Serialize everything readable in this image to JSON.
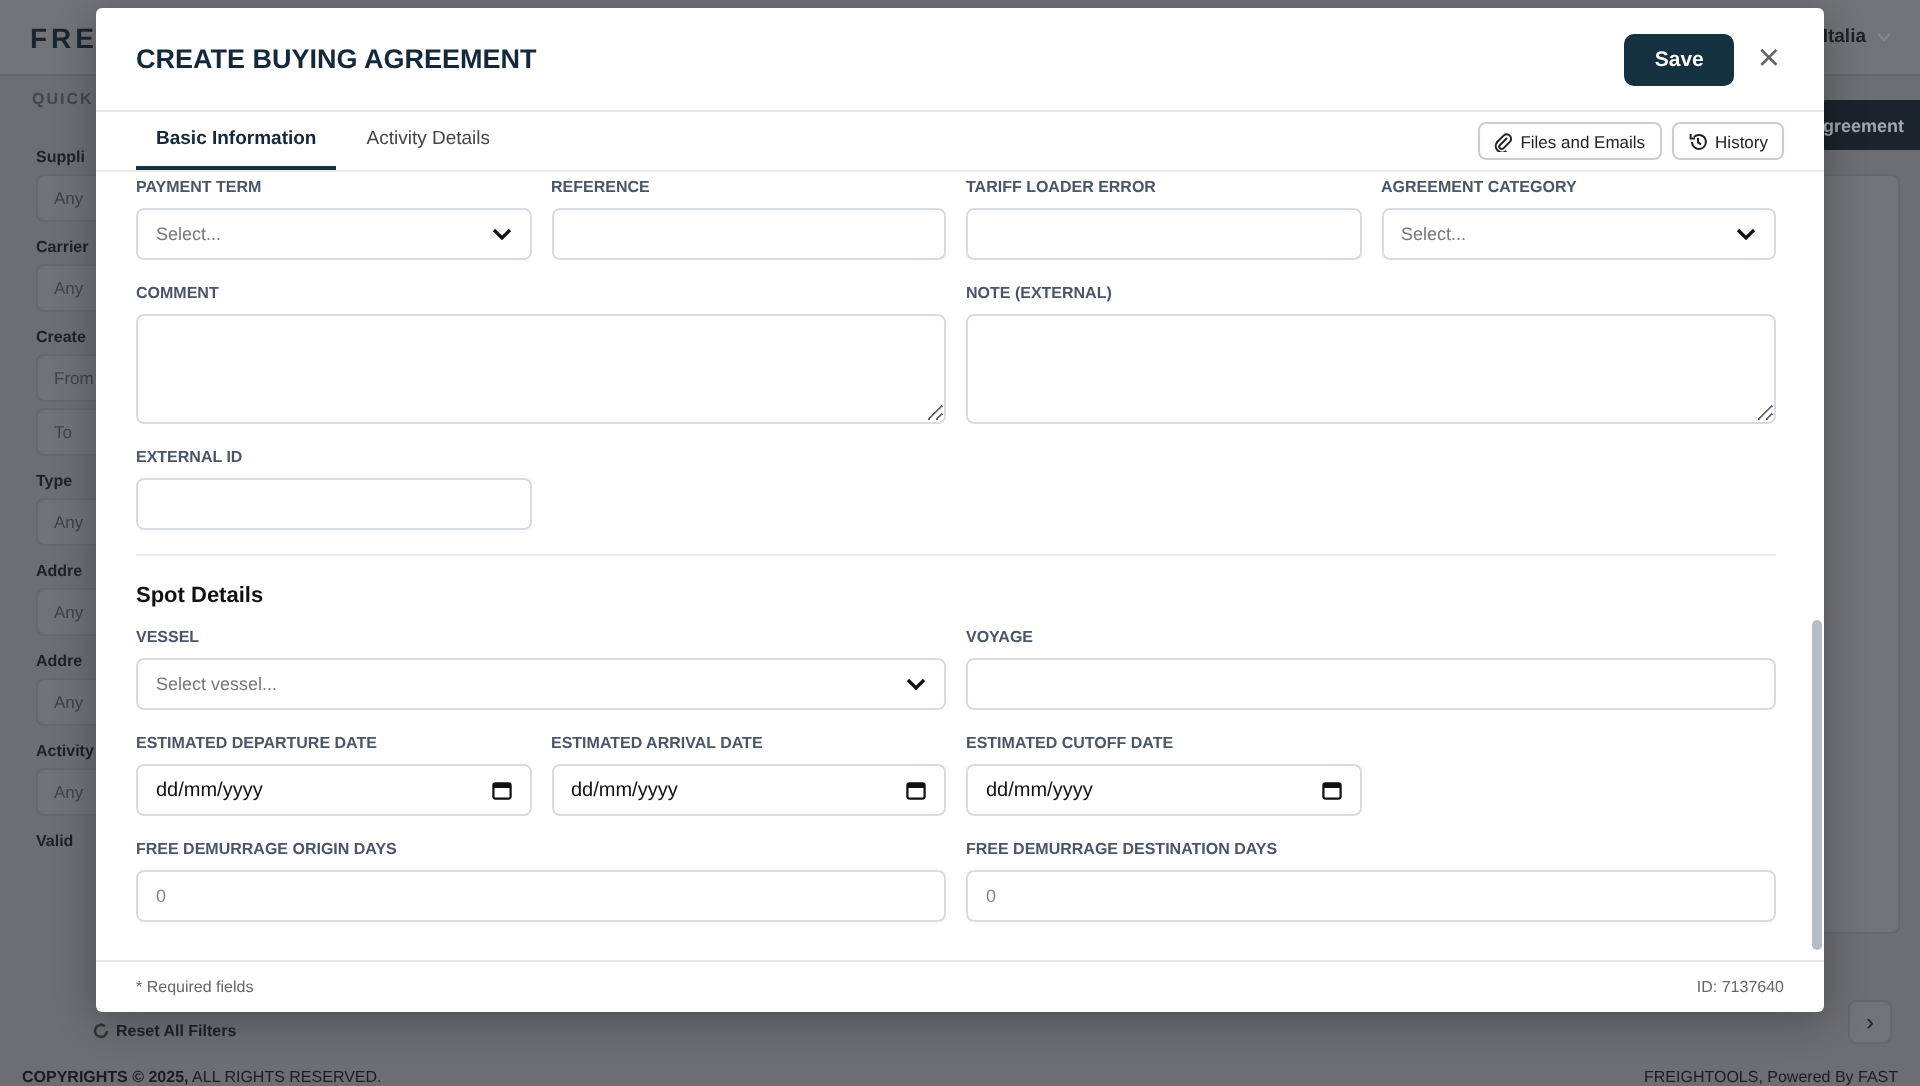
{
  "background": {
    "logo": "FRE",
    "header_right": "Italia",
    "section_label": "QUICK",
    "filters": [
      {
        "label": "Suppli",
        "fields": [
          {
            "placeholder": "Any"
          }
        ]
      },
      {
        "label": "Carrier",
        "fields": [
          {
            "placeholder": "Any"
          }
        ]
      },
      {
        "label": "Create",
        "fields": [
          {
            "placeholder": "From"
          },
          {
            "placeholder": "To"
          }
        ]
      },
      {
        "label": "Type",
        "fields": [
          {
            "placeholder": "Any"
          }
        ]
      },
      {
        "label": "Addre",
        "fields": [
          {
            "placeholder": "Any"
          }
        ]
      },
      {
        "label": "Addre",
        "fields": [
          {
            "placeholder": "Any"
          }
        ]
      },
      {
        "label": "Activity",
        "fields": [
          {
            "placeholder": "Any"
          }
        ]
      },
      {
        "label": "Valid"
      }
    ],
    "action_button": "greement",
    "reset": "Reset All Filters",
    "next_page": "›",
    "footer": {
      "copyright": "**COPYRIGHTS © 2025,** ALL RIGHTS RESERVED.",
      "credit": "FREIGHTOOLS, Powered By FAST"
    }
  },
  "modal": {
    "title": "CREATE BUYING AGREEMENT",
    "save": "Save",
    "close": "×",
    "tabs": [
      {
        "label": "Basic Information",
        "selected": true
      },
      {
        "label": "Activity Details",
        "selected": false
      }
    ],
    "actions": [
      {
        "label": "Files and Emails"
      },
      {
        "label": "History"
      }
    ],
    "sections": [
      {
        "rows": [
          {
            "fields": [
              {
                "label": "PAYMENT TERM",
                "kind": "select",
                "placeholder": "Select..."
              },
              {
                "label": "REFERENCE",
                "kind": "text"
              },
              {
                "label": "TARIFF LOADER ERROR",
                "kind": "text"
              },
              {
                "label": "AGREEMENT CATEGORY",
                "kind": "select",
                "placeholder": "Select..."
              }
            ]
          },
          {
            "fields": [
              {
                "label": "COMMENT",
                "kind": "textarea"
              },
              {
                "label": "NOTE (EXTERNAL)",
                "kind": "textarea"
              }
            ]
          },
          {
            "fields": [
              {
                "label": "EXTERNAL ID",
                "kind": "text"
              }
            ]
          }
        ]
      },
      {
        "title": "Spot Details",
        "rows": [
          {
            "fields": [
              {
                "label": "VESSEL",
                "kind": "select",
                "placeholder": "Select vessel..."
              },
              {
                "label": "VOYAGE",
                "kind": "text"
              }
            ]
          },
          {
            "fields": [
              {
                "label": "ESTIMATED DEPARTURE DATE",
                "kind": "date",
                "value": "dd/mm/yyyy"
              },
              {
                "label": "ESTIMATED ARRIVAL DATE",
                "kind": "date",
                "value": "dd/mm/yyyy"
              },
              {
                "label": "ESTIMATED CUTOFF DATE",
                "kind": "date",
                "value": "dd/mm/yyyy"
              }
            ]
          },
          {
            "fields": [
              {
                "label": "FREE DEMURRAGE ORIGIN DAYS",
                "kind": "number",
                "placeholder": "0"
              },
              {
                "label": "FREE DEMURRAGE DESTINATION DAYS",
                "kind": "number",
                "placeholder": "0"
              }
            ]
          }
        ]
      }
    ],
    "footer_note": "* Required fields",
    "record_id": "ID: 7137640"
  }
}
